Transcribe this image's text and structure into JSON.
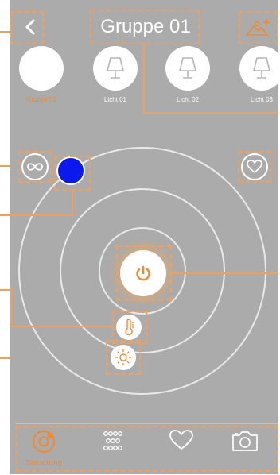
{
  "header": {
    "title": "Gruppe 01"
  },
  "lamps": [
    {
      "label": "Gruppe 01",
      "selected": true
    },
    {
      "label": "Licht 01",
      "selected": false
    },
    {
      "label": "Licht 02",
      "selected": false
    },
    {
      "label": "Licht 03",
      "selected": false
    }
  ],
  "color_dot": "#0b18ee",
  "accent": "#f08a30",
  "bottom_nav": {
    "items": [
      {
        "icon": "control-target-icon",
        "label": "Steuerung",
        "active": true
      },
      {
        "icon": "dot-grid-icon",
        "label": "",
        "active": false
      },
      {
        "icon": "heart-icon",
        "label": "",
        "active": false
      },
      {
        "icon": "camera-icon",
        "label": "",
        "active": false
      }
    ]
  }
}
